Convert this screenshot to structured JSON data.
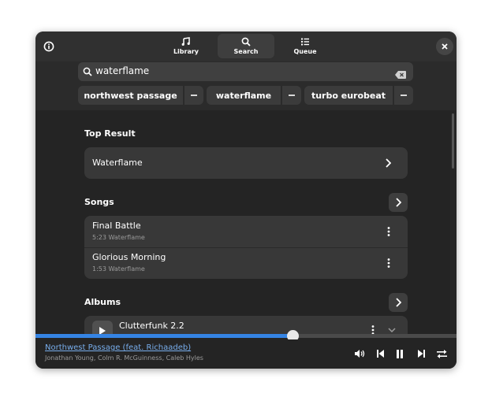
{
  "header": {
    "tabs": [
      {
        "label": "Library",
        "icon": "library-music-icon",
        "active": false
      },
      {
        "label": "Search",
        "icon": "search-icon",
        "active": true
      },
      {
        "label": "Queue",
        "icon": "queue-list-icon",
        "active": false
      }
    ]
  },
  "search": {
    "query": "waterflame",
    "history": [
      {
        "label": "northwest passage"
      },
      {
        "label": "waterflame"
      },
      {
        "label": "turbo eurobeat"
      }
    ]
  },
  "results": {
    "top_result": {
      "title": "Top Result",
      "item": "Waterflame"
    },
    "songs": {
      "title": "Songs",
      "items": [
        {
          "title": "Final Battle",
          "sub": "5:23 Waterflame"
        },
        {
          "title": "Glorious Morning",
          "sub": "1:53 Waterflame"
        }
      ]
    },
    "albums": {
      "title": "Albums",
      "items": [
        {
          "title": "Clutterfunk 2.2"
        }
      ]
    }
  },
  "player": {
    "track_title": "Northwest Passage (feat. Richaadeb)",
    "artists": "Jonathan Young, Colm R. McGuinness, Caleb Hyles",
    "progress": 0.61
  },
  "colors": {
    "accent": "#3584e4",
    "link": "#78aeed",
    "window_bg": "#242424",
    "card_bg": "#383838"
  }
}
